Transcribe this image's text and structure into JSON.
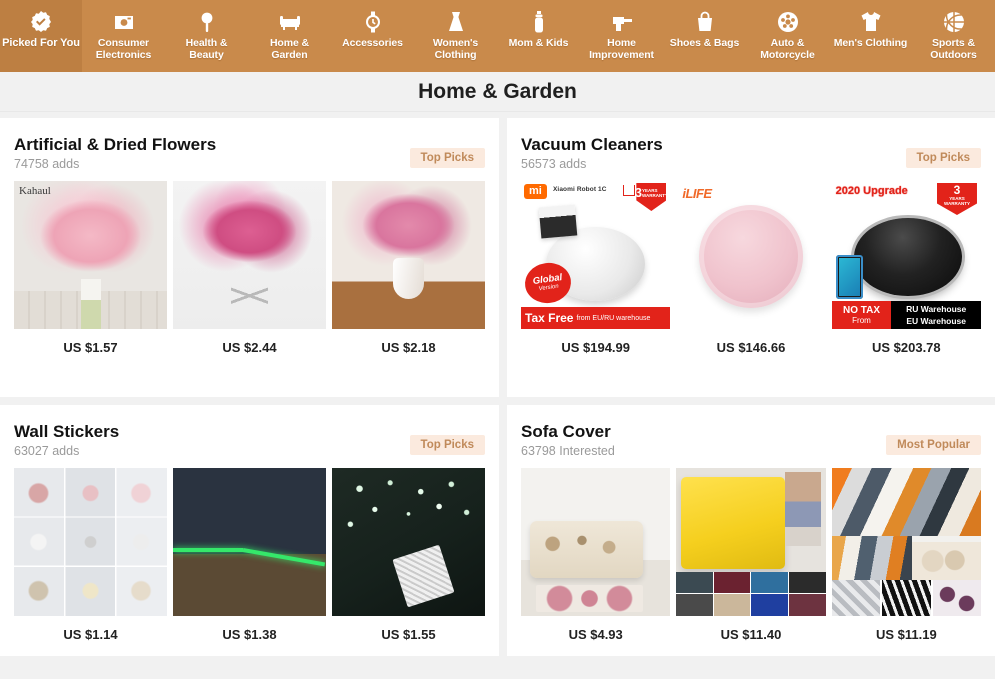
{
  "nav": {
    "items": [
      {
        "label": "Picked For You",
        "icon": "badge-check-icon",
        "active": true
      },
      {
        "label": "Consumer Electronics",
        "icon": "camera-icon",
        "active": false
      },
      {
        "label": "Health & Beauty",
        "icon": "mirror-icon",
        "active": false
      },
      {
        "label": "Home & Garden",
        "icon": "sofa-icon",
        "active": false
      },
      {
        "label": "Accessories",
        "icon": "watch-icon",
        "active": false
      },
      {
        "label": "Women's Clothing",
        "icon": "dress-icon",
        "active": false
      },
      {
        "label": "Mom & Kids",
        "icon": "baby-bottle-icon",
        "active": false
      },
      {
        "label": "Home Improvement",
        "icon": "drill-icon",
        "active": false
      },
      {
        "label": "Shoes & Bags",
        "icon": "handbag-icon",
        "active": false
      },
      {
        "label": "Auto & Motorcycle",
        "icon": "wheel-icon",
        "active": false
      },
      {
        "label": "Men's Clothing",
        "icon": "tshirt-icon",
        "active": false
      },
      {
        "label": "Sports & Outdoors",
        "icon": "basketball-icon",
        "active": false
      }
    ]
  },
  "header": {
    "title": "Home & Garden"
  },
  "sections": [
    {
      "title": "Artificial & Dried Flowers",
      "subtitle": "74758 adds",
      "badge": "Top Picks",
      "products": [
        {
          "price": "US $1.57",
          "watermark": "Kahaul"
        },
        {
          "price": "US $2.44"
        },
        {
          "price": "US $2.18"
        }
      ]
    },
    {
      "title": "Vacuum Cleaners",
      "subtitle": "56573 adds",
      "badge": "Top Picks",
      "products": [
        {
          "price": "US $194.99",
          "overlay": {
            "brand": "mi",
            "model": "Xiaomi Robot 1C",
            "warranty_years": "3",
            "warranty_text": "YEARS WARRANTY",
            "circle_title": "Global",
            "circle_sub": "Version",
            "banner_bold": "Tax Free",
            "banner_rest": "from EU/RU warehouse"
          }
        },
        {
          "price": "US $146.66",
          "overlay": {
            "brand": "iLIFE"
          }
        },
        {
          "price": "US $203.78",
          "overlay": {
            "upgrade": "2020 Upgrade",
            "warranty_years": "3",
            "warranty_text": "YEARS",
            "warranty_text2": "WARRANTY",
            "notax_bold": "NO TAX",
            "notax_sub": "From",
            "wh1": "RU Warehouse",
            "wh2": "EU Warehouse"
          }
        }
      ]
    },
    {
      "title": "Wall Stickers",
      "subtitle": "63027 adds",
      "badge": "Top Picks",
      "products": [
        {
          "price": "US $1.14"
        },
        {
          "price": "US $1.38"
        },
        {
          "price": "US $1.55"
        }
      ]
    },
    {
      "title": "Sofa Cover",
      "subtitle": "63798 Interested",
      "badge": "Most Popular",
      "products": [
        {
          "price": "US $4.93"
        },
        {
          "price": "US $11.40"
        },
        {
          "price": "US $11.19"
        }
      ]
    }
  ],
  "colors": {
    "nav_bg": "#c98a4b",
    "nav_active_bg": "#bd7f42",
    "badge_bg": "#fbeade",
    "badge_text": "#c08a5a",
    "page_bg": "#f1f1f1",
    "promo_red": "#e2231a"
  }
}
